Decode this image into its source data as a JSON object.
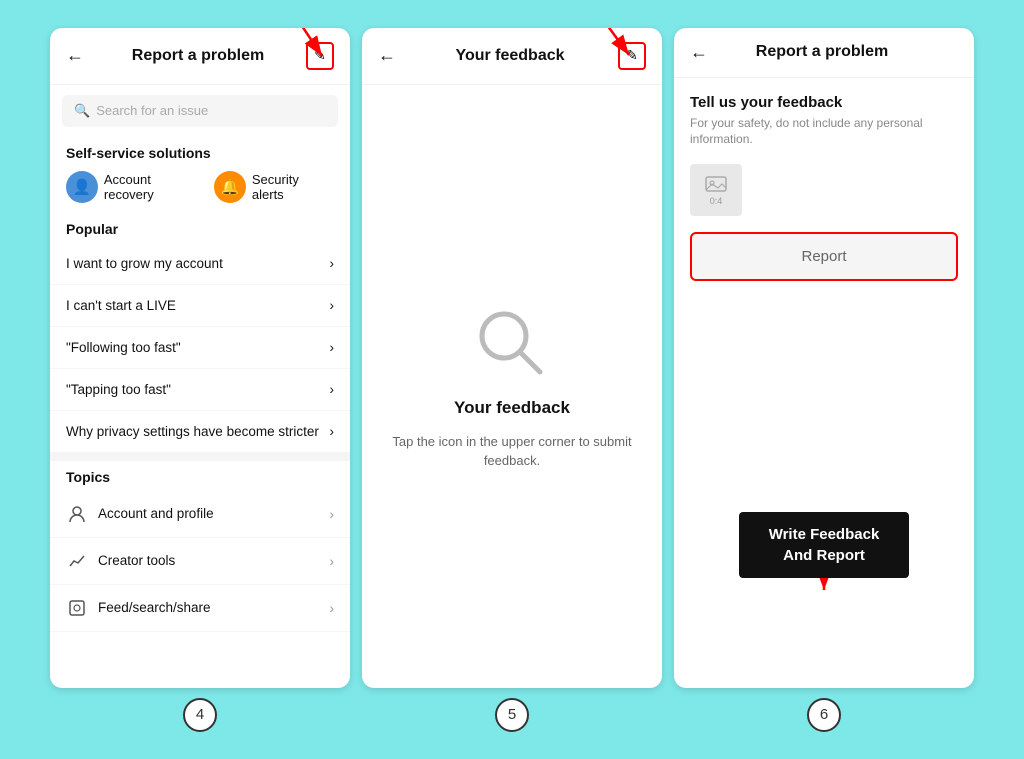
{
  "screen4": {
    "header": {
      "title": "Report a problem",
      "back_label": "←",
      "icon_label": "✎"
    },
    "search": {
      "placeholder": "Search for an issue"
    },
    "self_service": {
      "title": "Self-service solutions",
      "items": [
        {
          "label": "Account recovery",
          "icon": "👤",
          "color": "blue"
        },
        {
          "label": "Security alerts",
          "icon": "🔔",
          "color": "orange"
        }
      ]
    },
    "popular": {
      "title": "Popular",
      "items": [
        "I want to grow my account",
        "I can't start a LIVE",
        "\"Following too fast\"",
        "\"Tapping too fast\"",
        "Why privacy settings have become stricter"
      ]
    },
    "topics": {
      "title": "Topics",
      "items": [
        {
          "label": "Account and profile",
          "icon": "○"
        },
        {
          "label": "Creator tools",
          "icon": "📈"
        },
        {
          "label": "Feed/search/share",
          "icon": "⊡"
        }
      ]
    }
  },
  "screen5": {
    "header": {
      "title": "Your feedback",
      "back_label": "←",
      "icon_label": "✎"
    },
    "empty_state": {
      "title": "Your feedback",
      "subtitle": "Tap the icon in the upper corner to submit feedback."
    }
  },
  "screen6": {
    "header": {
      "title": "Report a problem",
      "back_label": "←"
    },
    "body": {
      "title": "Tell us your feedback",
      "subtitle": "For your safety, do not include any personal information.",
      "image_counter": "0:4",
      "report_button": "Report"
    },
    "annotation": "Write Feedback And Report"
  },
  "step_numbers": [
    "4",
    "5",
    "6"
  ]
}
